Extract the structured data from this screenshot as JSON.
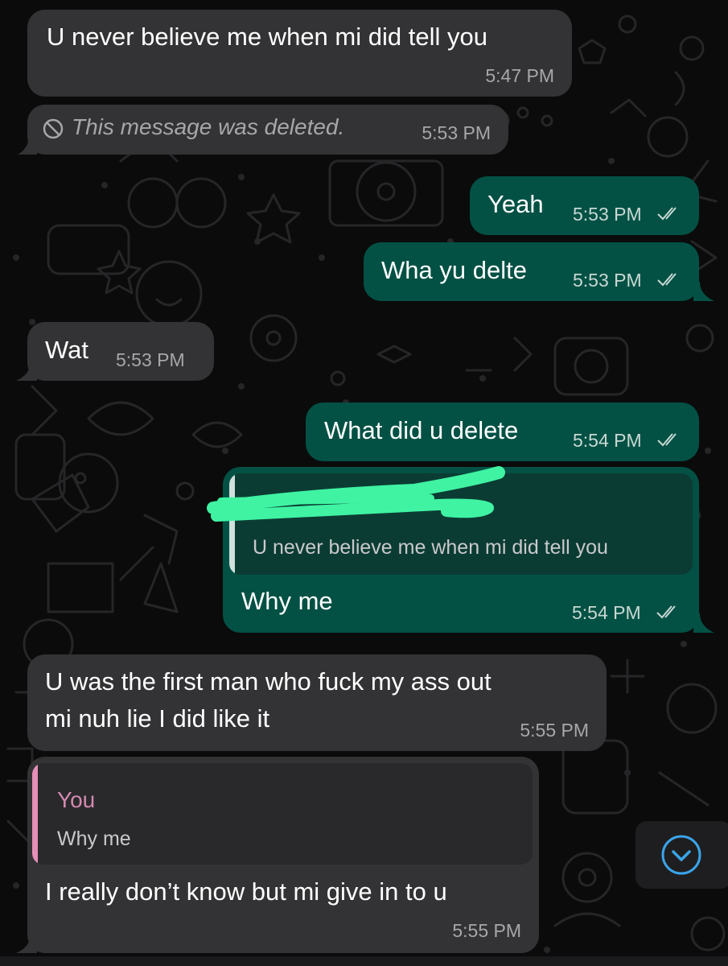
{
  "theme": {
    "incoming_bubble": "#333335",
    "outgoing_bubble": "#025144",
    "quote_you_accent": "#e58fb6",
    "scroll_icon_color": "#3aa4ea",
    "redaction_marker": "#3ff3a3"
  },
  "messages": [
    {
      "direction": "incoming",
      "text": "U never believe me when mi did tell you",
      "time": "5:47 PM"
    },
    {
      "direction": "incoming",
      "deleted": true,
      "text": "This message was deleted.",
      "time": "5:53 PM",
      "icon": "prohibited-icon"
    },
    {
      "direction": "outgoing",
      "text": "Yeah",
      "time": "5:53 PM",
      "status": "read"
    },
    {
      "direction": "outgoing",
      "text": "Wha yu delte",
      "time": "5:53 PM",
      "status": "read"
    },
    {
      "direction": "incoming",
      "text": "Wat",
      "time": "5:53 PM"
    },
    {
      "direction": "outgoing",
      "text": "What did u delete",
      "time": "5:54 PM",
      "status": "read"
    },
    {
      "direction": "outgoing",
      "reply_to": {
        "author": "",
        "text": "U never believe me when mi did tell you",
        "author_redacted": true
      },
      "text": "Why me",
      "time": "5:54 PM",
      "status": "read"
    },
    {
      "direction": "incoming",
      "text_lines": [
        "U was the first man who fuck my ass out",
        "mi nuh lie I did like it"
      ],
      "time": "5:55 PM"
    },
    {
      "direction": "incoming",
      "reply_to": {
        "author": "You",
        "text": "Why me"
      },
      "text": "I really don’t know but mi give in to u",
      "time": "5:55 PM"
    }
  ],
  "scroll_button": {
    "icon": "chevron-down-circle-icon"
  }
}
